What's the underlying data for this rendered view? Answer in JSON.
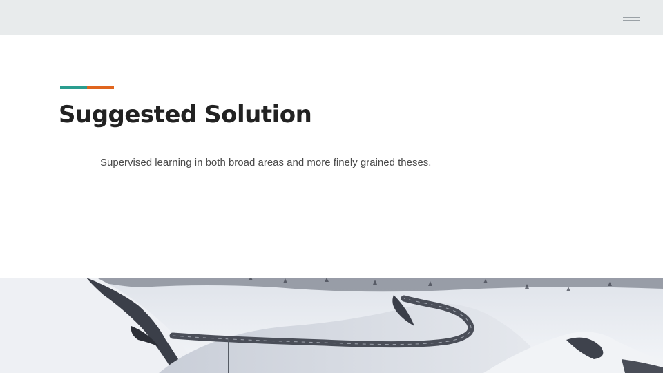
{
  "slide": {
    "title": "Suggested Solution",
    "body": "Supervised learning in both broad areas and more finely grained theses."
  },
  "header": {
    "menu_icon": "hamburger-menu-icon"
  },
  "image": {
    "icon": "snowy-mountain-road-photo"
  },
  "colors": {
    "header_band": "#e8ebec",
    "accent_teal": "#2a9d8f",
    "accent_orange": "#e0651e",
    "title": "#222222",
    "body": "#4a4a4a"
  }
}
